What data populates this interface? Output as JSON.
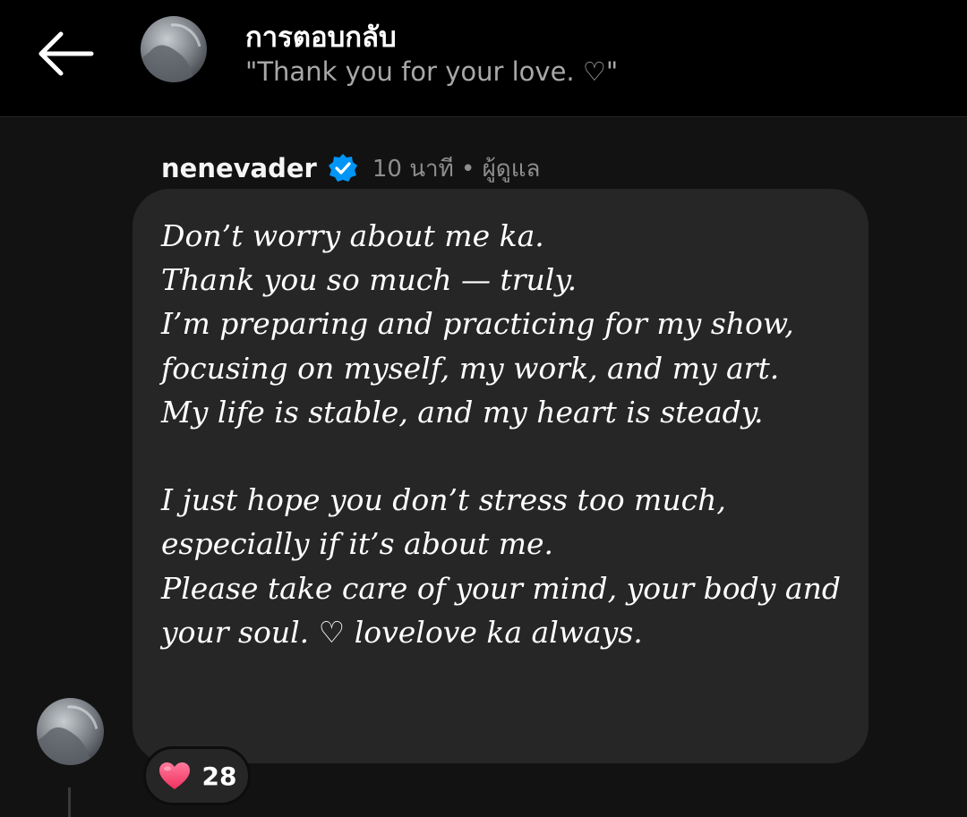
{
  "header": {
    "title": "การตอบกลับ",
    "subtitle": "\"Thank you for your love. ♡\"",
    "back_icon": "arrow-left-icon"
  },
  "comment": {
    "username": "nenevader",
    "verified": true,
    "verified_icon": "verified-badge-icon",
    "meta": "10 นาที • ผู้ดูแล",
    "message": "Don’t worry about me ka.\nThank you so much — truly.\nI’m preparing and practicing for my show,\nfocusing on myself, my work, and my art.\nMy life is stable, and my heart is steady.\n\nI just hope you don’t stress too much,\nespecially if it’s about me.\nPlease take care of your mind, your body and your soul. ♡ lovelove ka always.",
    "reaction": {
      "icon": "heart-icon",
      "count": "28"
    }
  },
  "colors": {
    "header_bg": "#000000",
    "page_bg": "#121212",
    "bubble_bg": "#262626",
    "verified_blue": "#0095f6",
    "heart_pink": "#ff3b6b"
  }
}
